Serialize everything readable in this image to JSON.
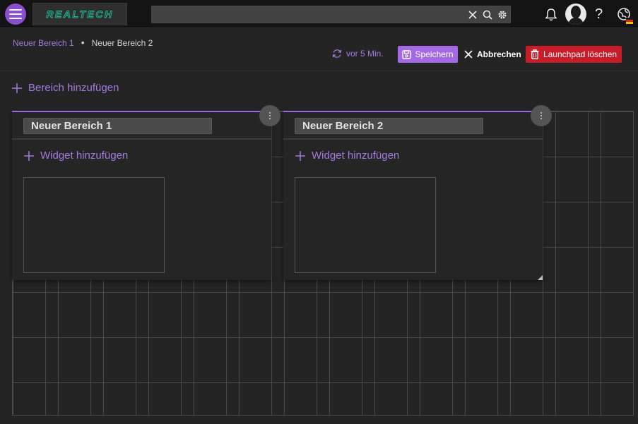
{
  "app": {
    "logo_text": "REALTECH",
    "accent_color": "#9a67de",
    "danger_color": "#c71c2a"
  },
  "topbar": {
    "menu_icon": "hamburger-menu-icon",
    "search": {
      "placeholder": "",
      "value": ""
    },
    "icons": [
      "clear-icon",
      "search-icon",
      "settings-icon",
      "bell-icon",
      "avatar",
      "help-icon",
      "language-globe-icon"
    ],
    "help_label": "?"
  },
  "breadcrumb": {
    "items": [
      "Neuer Bereich 1",
      "Neuer Bereich 2"
    ],
    "separator": "•"
  },
  "toolbar": {
    "autosave_label": "vor 5 Min.",
    "save_label": "Speichern",
    "cancel_label": "Abbrechen",
    "delete_label": "Launchpad löschen"
  },
  "main": {
    "add_area_label": "Bereich hinzufügen",
    "sections": [
      {
        "title": "Neuer Bereich 1",
        "add_widget_label": "Widget hinzufügen"
      },
      {
        "title": "Neuer Bereich 2",
        "add_widget_label": "Widget hinzufügen"
      }
    ]
  }
}
